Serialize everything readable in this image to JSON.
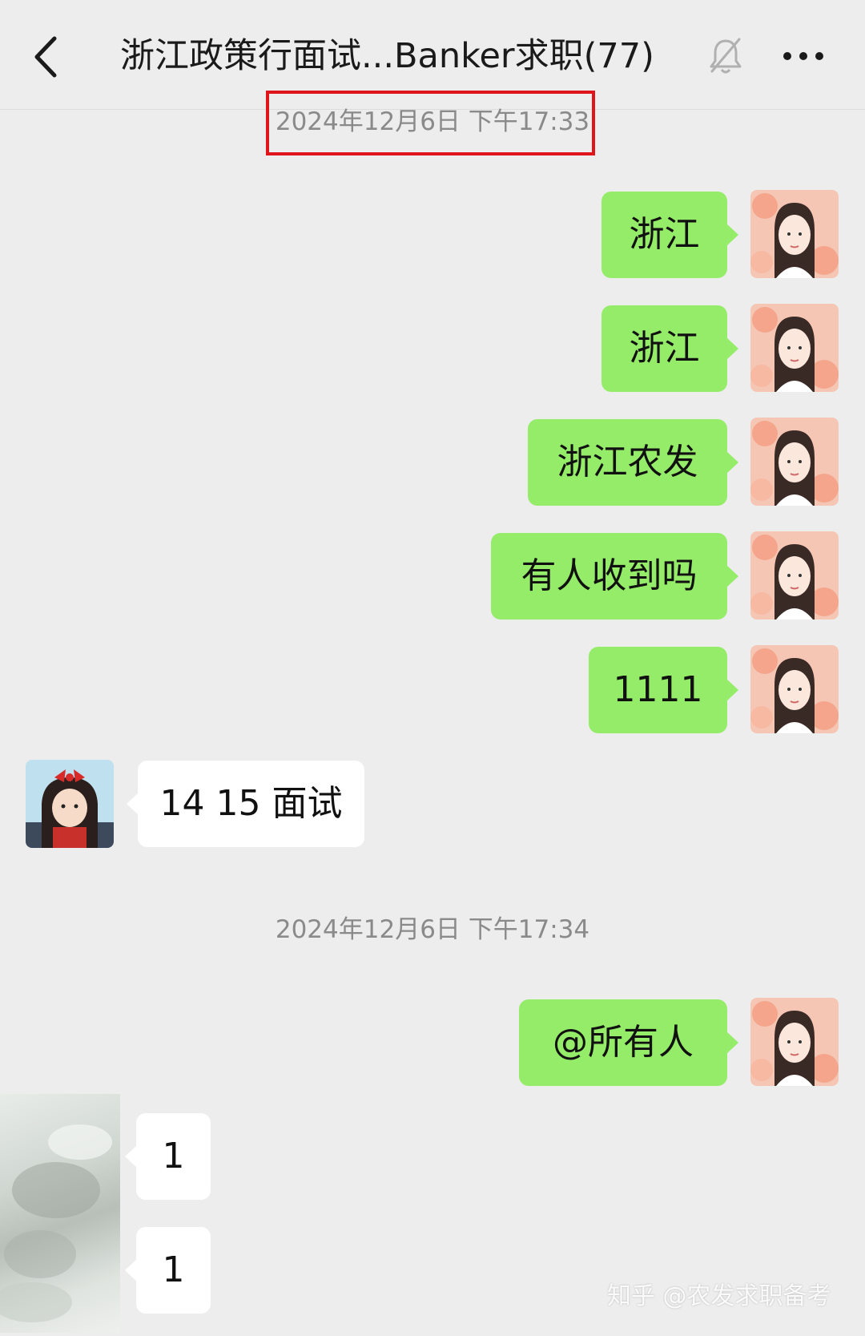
{
  "header": {
    "title": "浙江政策行面试...Banker求职(77)"
  },
  "timestamps": [
    "2024年12月6日 下午17:33",
    "2024年12月6日 下午17:34"
  ],
  "messages": [
    {
      "text": "浙江",
      "direction": "outgoing"
    },
    {
      "text": "浙江",
      "direction": "outgoing"
    },
    {
      "text": "浙江农发",
      "direction": "outgoing"
    },
    {
      "text": "有人收到吗",
      "direction": "outgoing"
    },
    {
      "text": "1111",
      "direction": "outgoing"
    },
    {
      "text": "14 15 面试",
      "direction": "incoming"
    },
    {
      "text": "@所有人",
      "direction": "outgoing"
    },
    {
      "text": "1",
      "direction": "incoming"
    },
    {
      "text": "1",
      "direction": "incoming"
    }
  ],
  "watermark": "知乎 @农发求职备考",
  "colors": {
    "background": "#ededed",
    "outgoing_bubble": "#95ec69",
    "incoming_bubble": "#ffffff",
    "highlight_box": "#e0151b",
    "timestamp_text": "#8a8a8a"
  },
  "icons": [
    "back-arrow-icon",
    "mute-bell-icon",
    "more-options-icon"
  ]
}
